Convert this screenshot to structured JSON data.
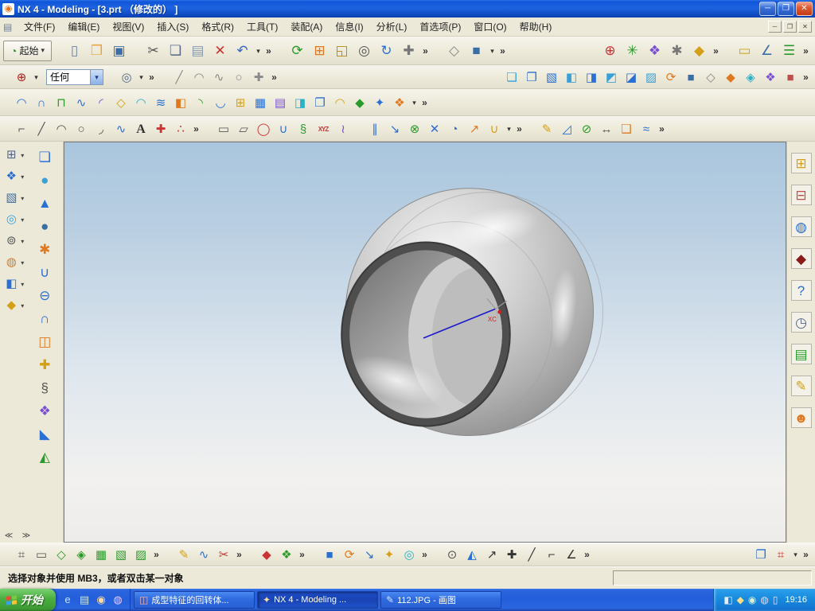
{
  "window": {
    "title": "NX 4 - Modeling - [3.prt （修改的） ]",
    "controls": [
      [
        "minimize-button",
        "─"
      ],
      [
        "maximize-button",
        "❐"
      ],
      [
        "close-button",
        "✕"
      ]
    ]
  },
  "mdi_controls": [
    [
      "mdi-minimize-button",
      "─"
    ],
    [
      "mdi-restore-button",
      "❐"
    ],
    [
      "mdi-close-button",
      "✕"
    ]
  ],
  "menu": {
    "items": [
      "文件(F)",
      "编辑(E)",
      "视图(V)",
      "插入(S)",
      "格式(R)",
      "工具(T)",
      "装配(A)",
      "信息(I)",
      "分析(L)",
      "首选项(P)",
      "窗口(O)",
      "帮助(H)"
    ]
  },
  "toolbars": {
    "start_label": "起始",
    "selection_filter": "任何",
    "row1_g1": [
      [
        "new-file-icon",
        "▯",
        "#6b7f9e"
      ],
      [
        "open-icon",
        "❒",
        "#e8a33d"
      ],
      [
        "save-icon",
        "▣",
        "#3a6ea5"
      ]
    ],
    "row1_g2": [
      [
        "cut-icon",
        "✂",
        "#555555"
      ],
      [
        "copy-icon",
        "❏",
        "#556688"
      ],
      [
        "paste-icon",
        "▤",
        "#8899aa"
      ],
      [
        "delete-icon",
        "✕",
        "#cc3333"
      ],
      [
        "undo-icon",
        "↶",
        "#3366cc"
      ],
      [
        "dropdown-arrow",
        "▾",
        "#333333"
      ],
      [
        "overflow-chevron",
        "»",
        "#333333"
      ]
    ],
    "row1_g3": [
      [
        "refresh-icon",
        "⟳",
        "#2a9a2a"
      ],
      [
        "fit-view-icon",
        "⊞",
        "#e07820"
      ],
      [
        "zoom-box-icon",
        "◱",
        "#b8860b"
      ],
      [
        "zoom-icon",
        "◎",
        "#555555"
      ],
      [
        "rotate-icon",
        "↻",
        "#2a6fd4"
      ],
      [
        "pan-icon",
        "✚",
        "#777777"
      ],
      [
        "overflow-chevron",
        "»",
        "#333333"
      ]
    ],
    "row1_g4": [
      [
        "wireframe-icon",
        "◇",
        "#888888"
      ],
      [
        "shaded-icon",
        "■",
        "#3a6ea5"
      ],
      [
        "dropdown-arrow",
        "▾",
        "#333333"
      ],
      [
        "overflow-chevron",
        "»",
        "#333333"
      ]
    ],
    "row1_g5": [
      [
        "orient-view-icon",
        "⊕",
        "#cc3333"
      ],
      [
        "csys-icon",
        "✳",
        "#2a9a2a"
      ],
      [
        "datum-display-icon",
        "❖",
        "#7a4fd4"
      ],
      [
        "preferences-icon",
        "✱",
        "#777777"
      ],
      [
        "visualization-icon",
        "◆",
        "#d4a017"
      ],
      [
        "overflow-chevron",
        "»",
        "#333333"
      ]
    ],
    "row1_g6": [
      [
        "measure-icon",
        "▭",
        "#d4a017"
      ],
      [
        "angle-icon",
        "∠",
        "#3a6ea5"
      ],
      [
        "info-window-icon",
        "☰",
        "#2a9a2a"
      ],
      [
        "overflow-chevron",
        "»",
        "#333333"
      ]
    ],
    "row2_g1": [
      [
        "snap-point-icon",
        "⊕",
        "#aa2222"
      ],
      [
        "dropdown-arrow",
        "▾",
        "#333333"
      ]
    ],
    "row2_g2": [
      [
        "selection-scope-icon",
        "◎",
        "#556688"
      ],
      [
        "dropdown-arrow",
        "▾",
        "#333333"
      ],
      [
        "overflow-chevron",
        "»",
        "#333333"
      ]
    ],
    "row2_g3": [
      [
        "line-snap-icon",
        "╱",
        "#8a8a8a"
      ],
      [
        "arc-snap-icon",
        "◠",
        "#8a8a8a"
      ],
      [
        "spline-snap-icon",
        "∿",
        "#8a8a8a"
      ],
      [
        "circle-snap-icon",
        "○",
        "#8a8a8a"
      ],
      [
        "point-snap-icon",
        "✚",
        "#8a8a8a"
      ],
      [
        "overflow-chevron",
        "»",
        "#333333"
      ]
    ],
    "row2_g4": [
      [
        "view-trimetric-icon",
        "❏",
        "#3aa0d8"
      ],
      [
        "view-isometric-icon",
        "❐",
        "#2a6fd4"
      ],
      [
        "view-top-icon",
        "▧",
        "#2a6fd4"
      ],
      [
        "view-front-icon",
        "◧",
        "#3aa0d8"
      ],
      [
        "view-right-icon",
        "◨",
        "#2a6fd4"
      ],
      [
        "view-left-icon",
        "◩",
        "#3aa0d8"
      ],
      [
        "view-back-icon",
        "◪",
        "#2a6fd4"
      ],
      [
        "view-bottom-icon",
        "▨",
        "#3aa0d8"
      ],
      [
        "rotate-view-icon",
        "⟳",
        "#e07820"
      ],
      [
        "shaded-view-icon",
        "■",
        "#3a6ea5"
      ],
      [
        "wireframe-view-icon",
        "◇",
        "#888888"
      ],
      [
        "studio-view-icon",
        "◆",
        "#e07820"
      ],
      [
        "face-analysis-icon",
        "◈",
        "#2ab0c8"
      ],
      [
        "snapshot-icon",
        "❖",
        "#7a4fd4"
      ],
      [
        "whole-assembly-icon",
        "■",
        "#c0504d"
      ],
      [
        "overflow-chevron",
        "»",
        "#333333"
      ]
    ],
    "row3_g1": [
      [
        "ruled-surface-icon",
        "◠",
        "#2a6fd4"
      ],
      [
        "through-curves-icon",
        "∩",
        "#2a6fd4"
      ],
      [
        "curve-mesh-icon",
        "⊓",
        "#2a9a2a"
      ],
      [
        "swept-icon",
        "∿",
        "#2a6fd4"
      ],
      [
        "section-surface-icon",
        "◜",
        "#7a4fd4"
      ],
      [
        "n-sided-surface-icon",
        "◇",
        "#d4a017"
      ],
      [
        "bridge-surface-icon",
        "◠",
        "#2ab0c8"
      ],
      [
        "offset-surface-icon",
        "≋",
        "#2a6fd4"
      ],
      [
        "trimmed-sheet-icon",
        "◧",
        "#e07820"
      ],
      [
        "extension-icon",
        "◝",
        "#2a9a2a"
      ],
      [
        "law-extension-icon",
        "◡",
        "#2a6fd4"
      ],
      [
        "enlarge-icon",
        "⊞",
        "#d4a017"
      ],
      [
        "sew-icon",
        "▦",
        "#2a6fd4"
      ],
      [
        "quilt-icon",
        "▤",
        "#7a4fd4"
      ],
      [
        "patch-icon",
        "◨",
        "#2ab0c8"
      ],
      [
        "thicken-icon",
        "❐",
        "#2a6fd4"
      ],
      [
        "fillet-surface-icon",
        "◠",
        "#d4a017"
      ],
      [
        "face-blend-icon",
        "◆",
        "#2a9a2a"
      ],
      [
        "soft-blend-icon",
        "✦",
        "#2a6fd4"
      ],
      [
        "styled-blend-icon",
        "❖",
        "#e07820"
      ],
      [
        "dropdown-arrow",
        "▾",
        "#333333"
      ],
      [
        "overflow-chevron",
        "»",
        "#333333"
      ]
    ],
    "row4_g1": [
      [
        "profile-icon",
        "⌐",
        "#555555"
      ],
      [
        "line-icon",
        "╱",
        "#555555"
      ],
      [
        "arc-icon",
        "◠",
        "#555555"
      ],
      [
        "circle-icon",
        "○",
        "#555555"
      ],
      [
        "fillet-icon",
        "◞",
        "#555555"
      ],
      [
        "spline-icon",
        "∿",
        "#2a6fd4"
      ],
      [
        "text-icon",
        "A",
        "#333333"
      ],
      [
        "point-icon",
        "✚",
        "#cc3333"
      ],
      [
        "point-set-icon",
        "∴",
        "#cc3333"
      ],
      [
        "overflow-chevron",
        "»",
        "#333333"
      ]
    ],
    "row4_g2": [
      [
        "rectangle-icon",
        "▭",
        "#555555"
      ],
      [
        "polygon-icon",
        "▱",
        "#555555"
      ],
      [
        "ellipse-icon",
        "◯",
        "#cc3333"
      ],
      [
        "conic-icon",
        "∪",
        "#2a6fd4"
      ],
      [
        "helix-icon",
        "§",
        "#2a9a2a"
      ],
      [
        "xyz-expression-icon",
        "XYZ",
        "#cc3333"
      ],
      [
        "law-curve-icon",
        "≀",
        "#7a4fd4"
      ]
    ],
    "row4_g3": [
      [
        "offset-curve-icon",
        "∥",
        "#2a6fd4"
      ],
      [
        "project-curve-icon",
        "↘",
        "#2a6fd4"
      ],
      [
        "combine-curve-icon",
        "⊗",
        "#2a9a2a"
      ],
      [
        "intersection-curve-icon",
        "✕",
        "#2a6fd4"
      ],
      [
        "section-curve-icon",
        "◔",
        "#2a6fd4"
      ],
      [
        "extract-curve-icon",
        "↗",
        "#e07820"
      ],
      [
        "join-curve-icon",
        "∪",
        "#d4a017"
      ],
      [
        "dropdown-arrow",
        "▾",
        "#333333"
      ],
      [
        "overflow-chevron",
        "»",
        "#333333"
      ]
    ],
    "row4_g4": [
      [
        "edit-curve-icon",
        "✎",
        "#d4a017"
      ],
      [
        "trim-curve-icon",
        "◿",
        "#2a6fd4"
      ],
      [
        "divide-curve-icon",
        "⊘",
        "#2a9a2a"
      ],
      [
        "curve-length-icon",
        "↔",
        "#555555"
      ],
      [
        "curve-param-icon",
        "❑",
        "#e07820"
      ],
      [
        "smooth-curve-icon",
        "≈",
        "#2a6fd4"
      ],
      [
        "overflow-chevron",
        "»",
        "#333333"
      ]
    ],
    "bottom_g1": [
      [
        "datum-grid-icon",
        "⌗",
        "#555555"
      ],
      [
        "sketch-plane-icon",
        "▭",
        "#555555"
      ],
      [
        "mesh-quad-icon",
        "◇",
        "#2a9a2a"
      ],
      [
        "mesh-tri-icon",
        "◈",
        "#2a9a2a"
      ],
      [
        "mesh-fine-icon",
        "▦",
        "#2a9a2a"
      ],
      [
        "mesh-coarse-icon",
        "▧",
        "#2a9a2a"
      ],
      [
        "mesh-map-icon",
        "▨",
        "#2a9a2a"
      ],
      [
        "overflow-chevron",
        "»",
        "#333333"
      ]
    ],
    "bottom_g2": [
      [
        "studio-spline-icon",
        "✎",
        "#d4a017"
      ],
      [
        "fit-spline-icon",
        "∿",
        "#2a6fd4"
      ],
      [
        "snip-surface-icon",
        "✂",
        "#cc3333"
      ],
      [
        "overflow-chevron",
        "»",
        "#333333"
      ]
    ],
    "bottom_g3": [
      [
        "deform-icon",
        "◆",
        "#cc3333"
      ],
      [
        "transform-icon",
        "❖",
        "#2a9a2a"
      ],
      [
        "overflow-chevron",
        "»",
        "#333333"
      ]
    ],
    "bottom_g4": [
      [
        "solid-tool-icon",
        "■",
        "#2a6fd4"
      ],
      [
        "update-icon",
        "⟳",
        "#e07820"
      ],
      [
        "move-face-icon",
        "↘",
        "#2a6fd4"
      ],
      [
        "highlight-icon",
        "✦",
        "#d4a017"
      ],
      [
        "locate-icon",
        "◎",
        "#2ab0c8"
      ],
      [
        "overflow-chevron",
        "»",
        "#333333"
      ]
    ],
    "bottom_g5": [
      [
        "circle-tool-icon",
        "⊙",
        "#555555"
      ],
      [
        "wedge-tool-icon",
        "◭",
        "#2a6fd4"
      ],
      [
        "vector-icon",
        "↗",
        "#333333"
      ],
      [
        "crosshair-icon",
        "✚",
        "#333333"
      ],
      [
        "slash-icon",
        "╱",
        "#333333"
      ],
      [
        "corner-icon",
        "⌐",
        "#333333"
      ],
      [
        "angle-tool-icon",
        "∠",
        "#333333"
      ],
      [
        "overflow-chevron",
        "»",
        "#333333"
      ]
    ],
    "bottom_g6": [
      [
        "sheet-tool-icon",
        "❐",
        "#2a6fd4"
      ],
      [
        "grid-tool-icon",
        "⌗",
        "#cc3333"
      ],
      [
        "dropdown-arrow",
        "▾",
        "#333333"
      ],
      [
        "overflow-chevron",
        "»",
        "#333333"
      ]
    ],
    "left_col1": [
      [
        "task-environment-icon",
        "⊞",
        "#556688"
      ],
      [
        "datum-plane-icon",
        "❖",
        "#2a6fd4"
      ],
      [
        "extrude-icon",
        "▧",
        "#3a6ea5"
      ],
      [
        "revolve-icon",
        "◎",
        "#3aa0d8"
      ],
      [
        "hole-icon",
        "⊚",
        "#555555"
      ],
      [
        "boss-icon",
        "◍",
        "#e07820"
      ],
      [
        "pocket-icon",
        "◧",
        "#2a6fd4"
      ],
      [
        "groove-icon",
        "◆",
        "#d4a017"
      ]
    ],
    "left_col2": [
      [
        "block-icon",
        "❏",
        "#2a6fd4"
      ],
      [
        "cylinder-icon",
        "●",
        "#3aa0d8"
      ],
      [
        "cone-icon",
        "▲",
        "#2a6fd4"
      ],
      [
        "sphere-icon",
        "●",
        "#3a6ea5"
      ],
      [
        "swirl-feature-icon",
        "✱",
        "#e07820"
      ],
      [
        "unite-icon",
        "∪",
        "#2a6fd4"
      ],
      [
        "subtract-icon",
        "⊖",
        "#2a6fd4"
      ],
      [
        "intersect-icon",
        "∩",
        "#2a6fd4"
      ],
      [
        "catalog-icon",
        "◫",
        "#e07820"
      ],
      [
        "user-defined-icon",
        "✚",
        "#d4a017"
      ],
      [
        "thread-icon",
        "§",
        "#555555"
      ],
      [
        "instance-icon",
        "❖",
        "#7a4fd4"
      ],
      [
        "trim-body-icon",
        "◣",
        "#2a6fd4"
      ],
      [
        "draft-icon",
        "◭",
        "#2a9a2a"
      ]
    ],
    "left_scroll": [
      [
        "scroll-left-icon",
        "≪",
        "#444444"
      ],
      [
        "scroll-right-icon",
        "≫",
        "#444444"
      ]
    ],
    "right_col": [
      [
        "assembly-navigator-icon",
        "⊞",
        "#d4a017"
      ],
      [
        "constraint-navigator-icon",
        "⊟",
        "#c0504d"
      ],
      [
        "web-browser-icon",
        "◍",
        "#2a6fd4"
      ],
      [
        "training-icon",
        "◆",
        "#8b1a1a"
      ],
      [
        "help-icon",
        "?",
        "#2a6fd4"
      ],
      [
        "history-icon",
        "◷",
        "#556688"
      ],
      [
        "notes-icon",
        "▤",
        "#2a9a2a"
      ],
      [
        "palette-icon",
        "✎",
        "#d4a017"
      ],
      [
        "roles-icon",
        "☻",
        "#e07820"
      ]
    ]
  },
  "viewport": {
    "axis_label": "XC"
  },
  "statusbar": {
    "message": "选择对象并使用 MB3，或者双击某一对象"
  },
  "taskbar": {
    "start_label": "开始",
    "quick_launch": [
      [
        "internet-explorer-icon",
        "e",
        "#bfe1ff"
      ],
      [
        "show-desktop-icon",
        "▤",
        "#cfe8cf"
      ],
      [
        "media-player-icon",
        "◉",
        "#ffd9a0"
      ],
      [
        "messenger-icon",
        "◍",
        "#e8c8ff"
      ]
    ],
    "tasks": [
      {
        "name": "task-button-1",
        "label": "成型特征的回转体...",
        "icon": "◫",
        "c": "#ffb3a0",
        "active": false
      },
      {
        "name": "task-button-2",
        "label": "NX 4 - Modeling ...",
        "icon": "✦",
        "c": "#ffd9a0",
        "active": true
      },
      {
        "name": "task-button-3",
        "label": "112.JPG - 画图",
        "icon": "✎",
        "c": "#cfe8ff",
        "active": false
      }
    ],
    "tray": [
      [
        "network-tray-icon",
        "◧",
        "#dfefff"
      ],
      [
        "shield-tray-icon",
        "◆",
        "#ffe08a"
      ],
      [
        "volume-tray-icon",
        "◉",
        "#d8f0d8"
      ],
      [
        "im-tray-icon",
        "◍",
        "#ffd0d0"
      ],
      [
        "battery-tray-icon",
        "▯",
        "#e0e0ff"
      ]
    ],
    "time": "19:16"
  },
  "colors": {
    "taskbar_blue": "#245edb",
    "start_green": "#3e9a35",
    "canvas_top": "#a9c6de",
    "canvas_bottom": "#edecea",
    "model_gray": "#c6c6c6",
    "axis_blue": "#1a1acc",
    "axis_label_red": "#cc2222"
  }
}
